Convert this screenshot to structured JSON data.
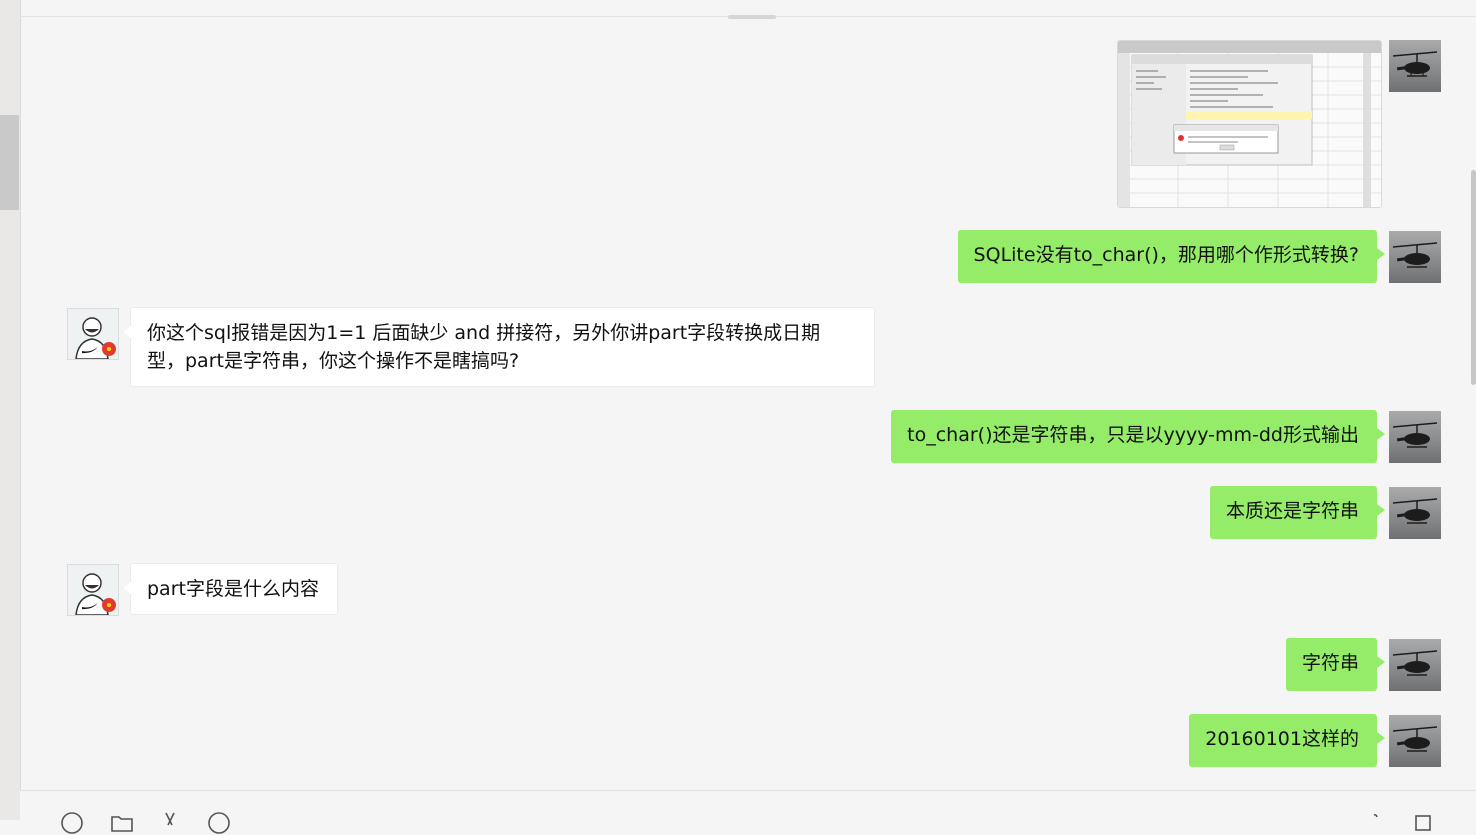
{
  "chat": {
    "messages": [
      {
        "dir": "out",
        "kind": "image",
        "alt": "screenshot-thumbnail"
      },
      {
        "dir": "out",
        "text": "SQLite没有to_char()，那用哪个作形式转换?"
      },
      {
        "dir": "in",
        "text": "你这个sql报错是因为1=1 后面缺少 and 拼接符，另外你讲part字段转换成日期型，part是字符串，你这个操作不是瞎搞吗?"
      },
      {
        "dir": "out",
        "text": "to_char()还是字符串，只是以yyyy-mm-dd形式输出"
      },
      {
        "dir": "out",
        "text": "本质还是字符串"
      },
      {
        "dir": "in",
        "text": "part字段是什么内容"
      },
      {
        "dir": "out",
        "text": "字符串"
      },
      {
        "dir": "out",
        "text": "20160101这样的"
      }
    ]
  },
  "avatars": {
    "me": "helicopter-avatar",
    "contact": "person-avatar"
  },
  "colors": {
    "outgoing_bubble": "#95ec69",
    "incoming_bubble": "#ffffff",
    "background": "#f5f5f5"
  },
  "toolbar": {
    "left_icons": [
      "emoji-icon",
      "folder-icon",
      "scissors-icon",
      "chat-history-icon"
    ],
    "right_icons": [
      "voice-call-icon",
      "video-call-icon"
    ]
  }
}
